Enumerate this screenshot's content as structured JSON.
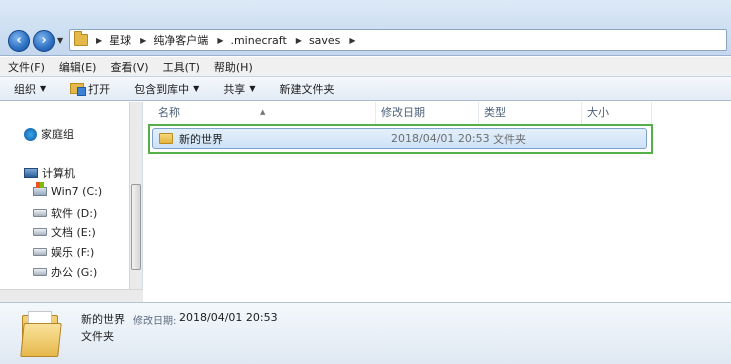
{
  "breadcrumb": [
    "星球",
    "纯净客户端",
    ".minecraft",
    "saves"
  ],
  "menu": [
    "文件(F)",
    "编辑(E)",
    "查看(V)",
    "工具(T)",
    "帮助(H)"
  ],
  "commands": {
    "organize": "组织",
    "open": "打开",
    "include_in_library": "包含到库中",
    "share": "共享",
    "new_folder": "新建文件夹"
  },
  "nav": {
    "homegroup": "家庭组",
    "computer": "计算机",
    "drives": [
      "Win7 (C:)",
      "软件 (D:)",
      "文档 (E:)",
      "娱乐 (F:)",
      "办公 (G:)"
    ]
  },
  "columns": {
    "name": "名称",
    "date": "修改日期",
    "type": "类型",
    "size": "大小"
  },
  "files": [
    {
      "name": "新的世界",
      "date": "2018/04/01 20:53",
      "type": "文件夹",
      "size": ""
    }
  ],
  "details": {
    "name": "新的世界",
    "date_label": "修改日期:",
    "date": "2018/04/01 20:53",
    "type": "文件夹"
  },
  "colors": {
    "selection_outline": "#56b04a",
    "selection_fill": "#cde2f7",
    "folder": "#e5b84a"
  }
}
